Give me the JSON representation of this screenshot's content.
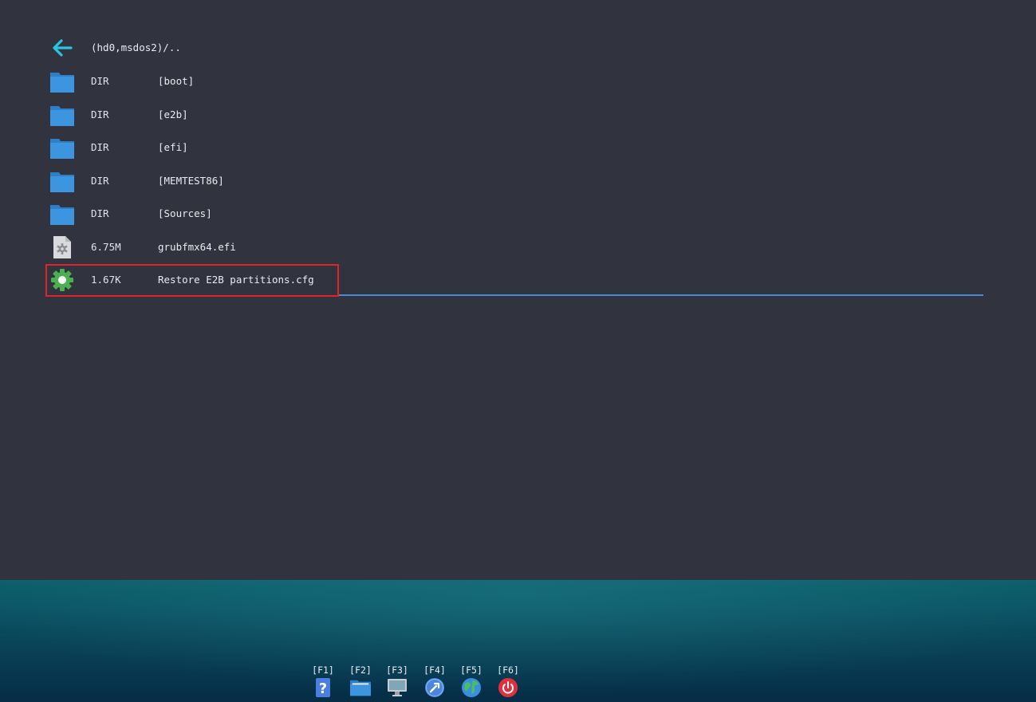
{
  "browser": {
    "parent_entry": {
      "label": "(hd0,msdos2)/..",
      "icon": "back-arrow-icon"
    },
    "entries": [
      {
        "size": "DIR",
        "name": "[boot]",
        "icon": "folder-icon"
      },
      {
        "size": "DIR",
        "name": "[e2b]",
        "icon": "folder-icon"
      },
      {
        "size": "DIR",
        "name": "[efi]",
        "icon": "folder-icon"
      },
      {
        "size": "DIR",
        "name": "[MEMTEST86]",
        "icon": "folder-icon"
      },
      {
        "size": "DIR",
        "name": "[Sources]",
        "icon": "folder-icon"
      },
      {
        "size": "6.75M",
        "name": "grubfmx64.efi",
        "icon": "efi-file-icon"
      },
      {
        "size": "1.67K",
        "name": "Restore E2B partitions.cfg",
        "icon": "config-gear-icon",
        "selected": true
      }
    ]
  },
  "taskbar": {
    "keys": [
      {
        "label": "[F1]",
        "icon": "help-icon"
      },
      {
        "label": "[F2]",
        "icon": "file-manager-icon"
      },
      {
        "label": "[F3]",
        "icon": "display-icon"
      },
      {
        "label": "[F4]",
        "icon": "tools-icon"
      },
      {
        "label": "[F5]",
        "icon": "globe-icon"
      },
      {
        "label": "[F6]",
        "icon": "power-icon"
      }
    ]
  },
  "colors": {
    "background": "#31343f",
    "selection_border": "#e0242c",
    "selection_underline": "#4a88d6",
    "folder": "#3d95e0",
    "back_arrow": "#2ec4e0",
    "config_gear": "#4caf50"
  }
}
